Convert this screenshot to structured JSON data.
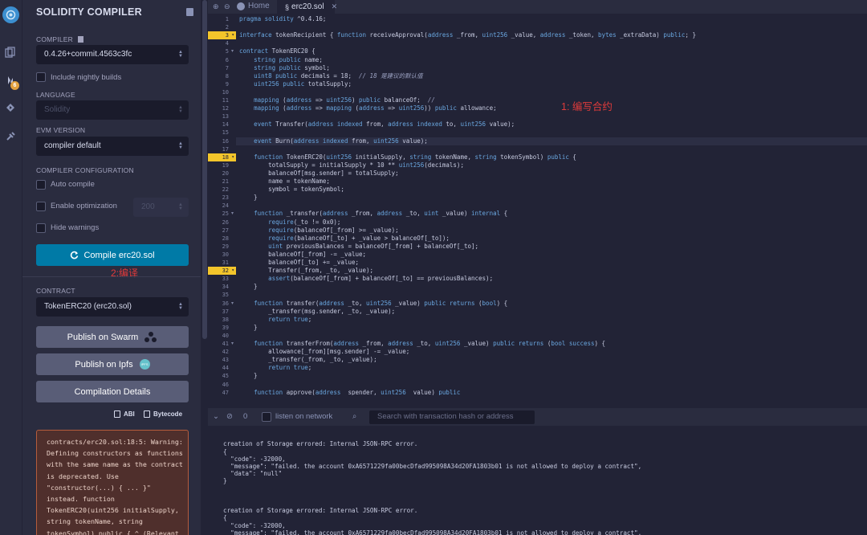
{
  "panel": {
    "title": "SOLIDITY COMPILER",
    "compiler_label": "COMPILER",
    "compiler_value": "0.4.26+commit.4563c3fc",
    "include_nightly": "Include nightly builds",
    "language_label": "LANGUAGE",
    "language_value": "Solidity",
    "evm_label": "EVM VERSION",
    "evm_value": "compiler default",
    "config_label": "COMPILER CONFIGURATION",
    "auto_compile": "Auto compile",
    "enable_opt": "Enable optimization",
    "runs_value": "200",
    "hide_warnings": "Hide warnings",
    "compile_button": "Compile erc20.sol",
    "annotation_compile": "2:编译",
    "contract_label": "CONTRACT",
    "contract_value": "TokenERC20 (erc20.sol)",
    "publish_swarm": "Publish on Swarm",
    "publish_ipfs": "Publish on Ipfs",
    "ipfs_icon_text": "IPFS",
    "details_button": "Compilation Details",
    "abi_label": "ABI",
    "bytecode_label": "Bytecode",
    "warning_text": "contracts/erc20.sol:18:5: Warning:\nDefining constructors as functions\nwith the same name as the contract\nis deprecated. Use\n\"constructor(...) { ... }\"\ninstead. function\nTokenERC20(uint256 initialSupply,\nstring tokenName, string\ntokenSymbol) public { ^ (Relevant",
    "rail_badge": "6"
  },
  "tabs": {
    "home": "Home",
    "file": "erc20.sol"
  },
  "editor": {
    "annotation_write": "1: 编写合约",
    "highlighted_lines": [
      3,
      18,
      32
    ],
    "current_line": 16,
    "fold_lines": [
      5,
      18,
      25,
      36,
      41
    ],
    "lines": [
      "pragma solidity ^0.4.16;",
      "",
      "interface tokenRecipient { function receiveApproval(address _from, uint256 _value, address _token, bytes _extraData) public; }",
      "",
      "contract TokenERC20 {",
      "    string public name;",
      "    string public symbol;",
      "    uint8 public decimals = 18;  // 18 是建议的默认值",
      "    uint256 public totalSupply;",
      "",
      "    mapping (address => uint256) public balanceOf;  //",
      "    mapping (address => mapping (address => uint256)) public allowance;",
      "",
      "    event Transfer(address indexed from, address indexed to, uint256 value);",
      "",
      "    event Burn(address indexed from, uint256 value);",
      "",
      "    function TokenERC20(uint256 initialSupply, string tokenName, string tokenSymbol) public {",
      "        totalSupply = initialSupply * 10 ** uint256(decimals);",
      "        balanceOf[msg.sender] = totalSupply;",
      "        name = tokenName;",
      "        symbol = tokenSymbol;",
      "    }",
      "",
      "    function _transfer(address _from, address _to, uint _value) internal {",
      "        require(_to != 0x0);",
      "        require(balanceOf[_from] >= _value);",
      "        require(balanceOf[_to] + _value > balanceOf[_to]);",
      "        uint previousBalances = balanceOf[_from] + balanceOf[_to];",
      "        balanceOf[_from] -= _value;",
      "        balanceOf[_to] += _value;",
      "        Transfer(_from, _to, _value);",
      "        assert(balanceOf[_from] + balanceOf[_to] == previousBalances);",
      "    }",
      "",
      "    function transfer(address _to, uint256 _value) public returns (bool) {",
      "        _transfer(msg.sender, _to, _value);",
      "        return true;",
      "    }",
      "",
      "    function transferFrom(address _from, address _to, uint256 _value) public returns (bool success) {",
      "        allowance[_from][msg.sender] -= _value;",
      "        _transfer(_from, _to, _value);",
      "        return true;",
      "    }",
      "",
      "    function approve(address _spender, uint256 _value) public"
    ]
  },
  "terminal": {
    "count": "0",
    "listen_label": "listen on network",
    "search_placeholder": "Search with transaction hash or address",
    "output": "creation of Storage errored: Internal JSON-RPC error.\n{\n  \"code\": -32000,\n  \"message\": \"failed. the account 0xA6571229fa00becDfad995098A34d20FA1803b01 is not allowed to deploy a contract\",\n  \"data\": \"null\"\n}\n\n\n\ncreation of Storage errored: Internal JSON-RPC error.\n{\n  \"code\": -32000,\n  \"message\": \"failed. the account 0xA6571229fa00becDfad995098A34d20FA1803b01 is not allowed to deploy a contract\",\n  \"data\": \"null\"\n}"
  }
}
